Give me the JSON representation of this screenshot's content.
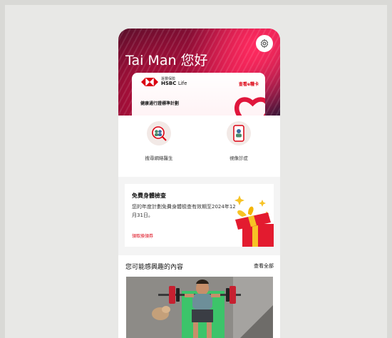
{
  "greeting": "Tai Man 您好",
  "card": {
    "logo_cn": "滙豐保險",
    "logo_en": "HSBC",
    "logo_sub": "Life",
    "link": "查看e糧卡",
    "plan": "健康通行證標準計劃"
  },
  "services": [
    {
      "label": "搜尋網絡醫生",
      "icon": "doctor-search-icon"
    },
    {
      "label": "視像診症",
      "icon": "video-consultation-icon"
    }
  ],
  "promo": {
    "title": "免費身體檢查",
    "description": "您的年度計劃免費身體檢查有效期至2024年12月31日。",
    "link": "領取換領券"
  },
  "interest": {
    "title": "您可能感興趣的內容",
    "view_all": "查看全部"
  },
  "colors": {
    "brand_red": "#db0011",
    "hero_magenta": "#d81b4d",
    "gift_yellow": "#f7c325"
  }
}
